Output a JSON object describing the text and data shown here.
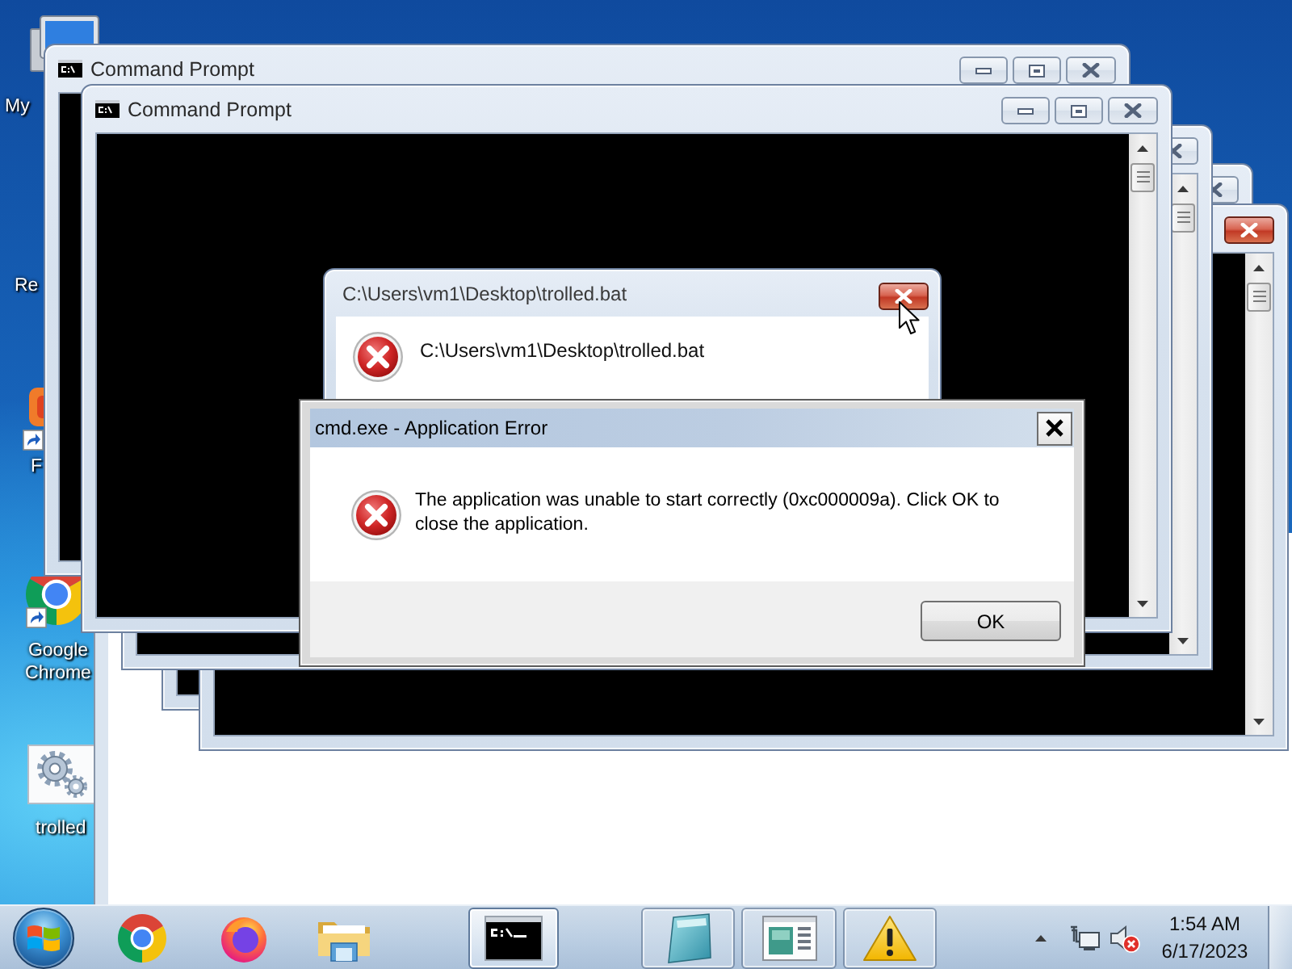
{
  "desktop": {
    "icons": [
      {
        "label": "My"
      },
      {
        "label": "Re"
      },
      {
        "label": "F"
      },
      {
        "label": "Google Chrome"
      },
      {
        "label": "trolled"
      }
    ]
  },
  "console_windows": [
    {
      "title": "Command Prompt",
      "active": false
    },
    {
      "title": "Command Prompt",
      "active": false
    },
    {
      "active": false
    },
    {
      "active": false
    },
    {
      "active": true
    }
  ],
  "file_error_dialog": {
    "title": "C:\\Users\\vm1\\Desktop\\trolled.bat",
    "close_hovered": true,
    "message": "C:\\Users\\vm1\\Desktop\\trolled.bat"
  },
  "app_error_dialog": {
    "title": "cmd.exe - Application Error",
    "message": "The application was unable to start correctly (0xc000009a). Click OK to close the application.",
    "buttons": [
      "OK"
    ]
  },
  "taskbar": {
    "buttons": [
      {
        "running": false,
        "active": false
      },
      {
        "running": false,
        "active": false
      },
      {
        "running": false,
        "active": false
      },
      {
        "running": true,
        "active": true
      },
      {
        "running": true,
        "active": false
      },
      {
        "running": true,
        "active": false
      },
      {
        "running": true,
        "active": false
      }
    ],
    "tray": {
      "volume_muted": true
    },
    "clock": {
      "time": "1:54 AM",
      "date": "6/17/2023"
    }
  }
}
